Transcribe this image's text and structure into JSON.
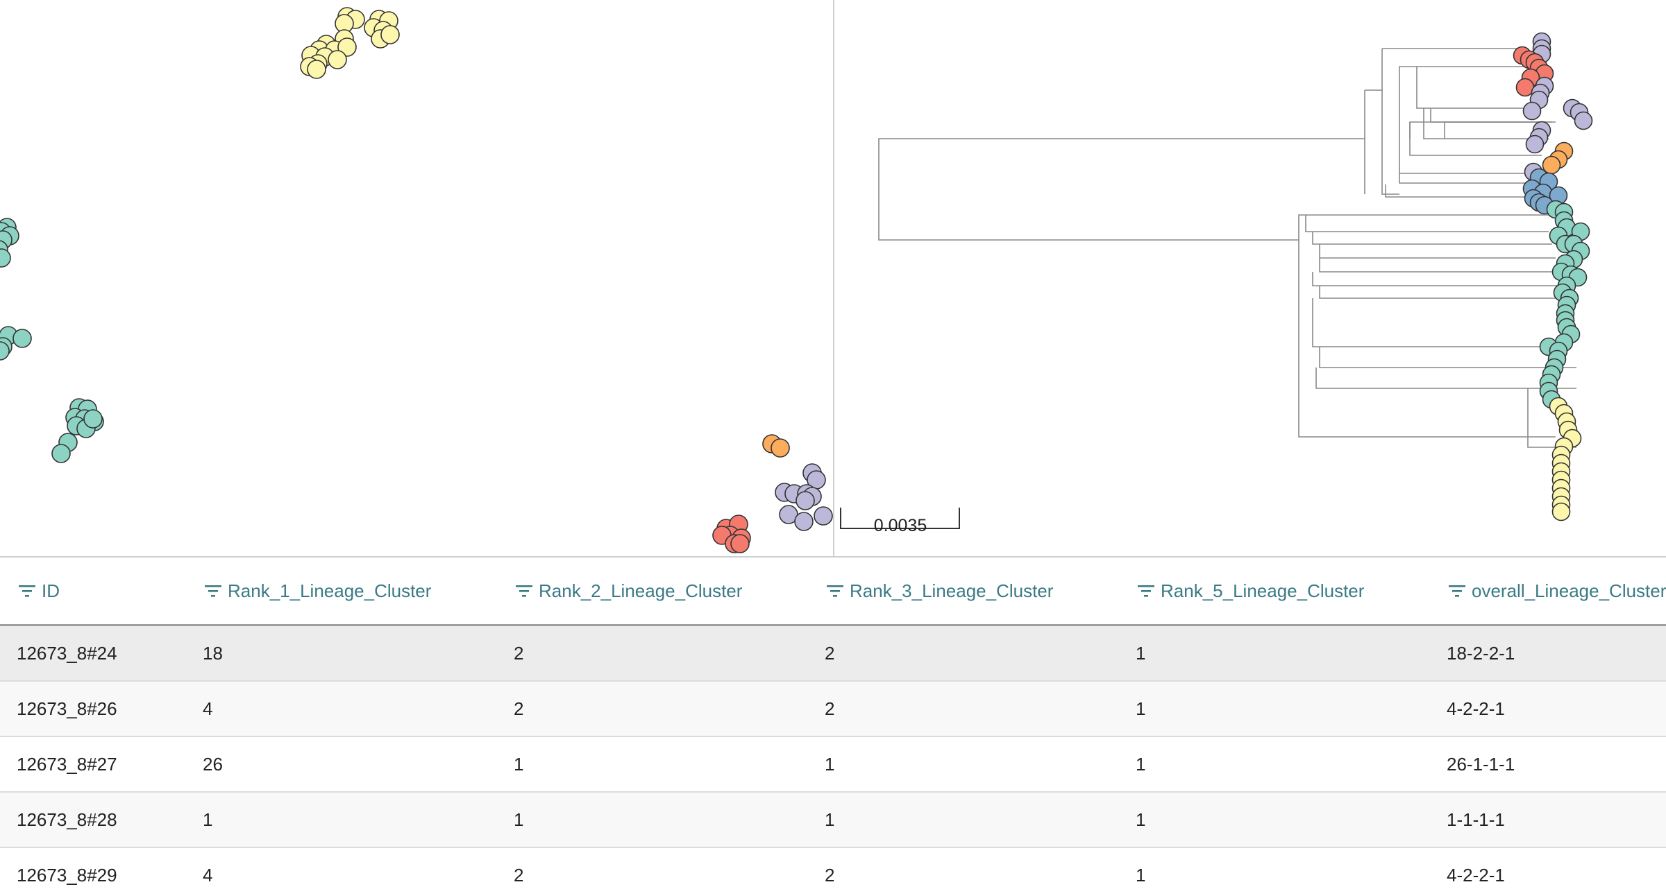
{
  "colors": {
    "yellow": "#fdf7ae",
    "teal": "#8dd3c4",
    "orange": "#fbac5c",
    "purple": "#bcb8d9",
    "red": "#f47a6e",
    "blue": "#7ea9cf",
    "header_text": "#3a7a85"
  },
  "tree": {
    "scale_label": "0.0035"
  },
  "table": {
    "columns": [
      {
        "label": "ID"
      },
      {
        "label": "Rank_1_Lineage_Cluster"
      },
      {
        "label": "Rank_2_Lineage_Cluster"
      },
      {
        "label": "Rank_3_Lineage_Cluster"
      },
      {
        "label": "Rank_5_Lineage_Cluster"
      },
      {
        "label": "overall_Lineage_Cluster"
      }
    ],
    "rows": [
      {
        "cells": [
          "12673_8#24",
          "18",
          "2",
          "2",
          "1",
          "18-2-2-1"
        ]
      },
      {
        "cells": [
          "12673_8#26",
          "4",
          "2",
          "2",
          "1",
          "4-2-2-1"
        ]
      },
      {
        "cells": [
          "12673_8#27",
          "26",
          "1",
          "1",
          "1",
          "26-1-1-1"
        ]
      },
      {
        "cells": [
          "12673_8#28",
          "1",
          "1",
          "1",
          "1",
          "1-1-1-1"
        ]
      },
      {
        "cells": [
          "12673_8#29",
          "4",
          "2",
          "2",
          "1",
          "4-2-2-1"
        ]
      }
    ]
  }
}
